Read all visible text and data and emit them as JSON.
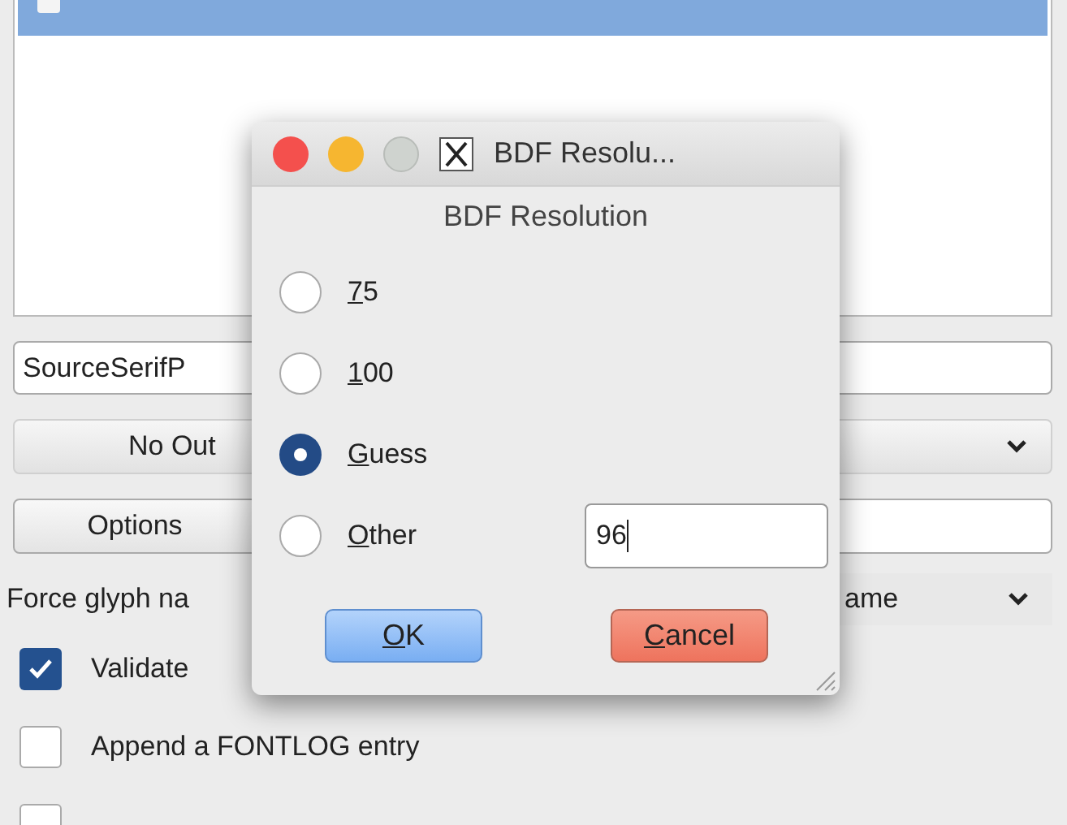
{
  "list": {
    "selected_row": {
      "selected": true
    }
  },
  "name_field": {
    "value": "SourceSerifP"
  },
  "outline_dropdown": {
    "value": "No Out"
  },
  "options_button": {
    "label": "Options"
  },
  "force_glyph": {
    "label": "Force glyph na",
    "value": "ame"
  },
  "checkboxes": [
    {
      "label": "Validate",
      "checked": true
    },
    {
      "label": "Append a FONTLOG entry",
      "checked": false
    },
    {
      "checked": false
    }
  ],
  "dialog": {
    "title": "BDF Resolu...",
    "heading": "BDF Resolution",
    "options": [
      {
        "label": "75",
        "selected": false
      },
      {
        "label": "100",
        "selected": false
      },
      {
        "label": "Guess",
        "selected": true
      },
      {
        "label": "Other",
        "selected": false
      }
    ],
    "other_value": "96",
    "buttons": [
      {
        "label": "OK",
        "kind": "default"
      },
      {
        "label": "Cancel",
        "kind": "cancel"
      }
    ]
  }
}
